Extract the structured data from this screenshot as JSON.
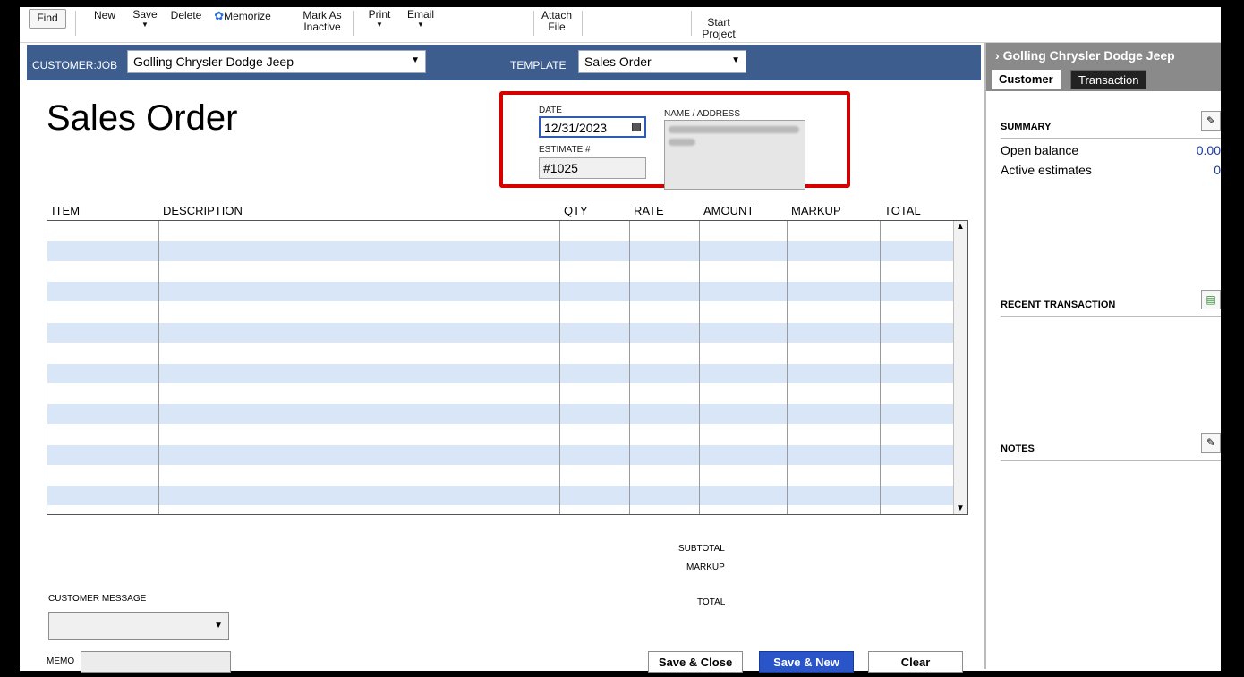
{
  "toolbar": {
    "find": "Find",
    "new": "New",
    "save": "Save",
    "delete": "Delete",
    "memorize": "Memorize",
    "mark_inactive_1": "Mark As",
    "mark_inactive_2": "Inactive",
    "print": "Print",
    "email": "Email",
    "attach_1": "Attach",
    "attach_2": "File",
    "start_1": "Start",
    "start_2": "Project"
  },
  "header": {
    "customer_label": "CUSTOMER:JOB",
    "customer_value": "Golling Chrysler Dodge Jeep",
    "template_label": "TEMPLATE",
    "template_value": "Sales Order"
  },
  "form": {
    "title": "Sales Order",
    "date_label": "DATE",
    "date_value": "12/31/2023",
    "estimate_label": "ESTIMATE #",
    "estimate_value": "#1025",
    "address_label": "NAME / ADDRESS"
  },
  "grid": {
    "columns": [
      "ITEM",
      "DESCRIPTION",
      "QTY",
      "RATE",
      "AMOUNT",
      "MARKUP",
      "TOTAL"
    ]
  },
  "totals": {
    "subtotal": "SUBTOTAL",
    "markup": "MARKUP",
    "total": "TOTAL"
  },
  "footer": {
    "customer_message": "CUSTOMER MESSAGE",
    "memo": "MEMO",
    "save_close": "Save & Close",
    "save_new": "Save & New",
    "clear": "Clear"
  },
  "side": {
    "title": "Golling Chrysler Dodge Jeep",
    "tab_customer": "Customer",
    "tab_transaction": "Transaction",
    "summary": "SUMMARY",
    "open_balance_label": "Open balance",
    "open_balance_value": "0.00",
    "active_estimates_label": "Active estimates",
    "active_estimates_value": "0",
    "recent": "RECENT TRANSACTION",
    "notes": "NOTES"
  }
}
